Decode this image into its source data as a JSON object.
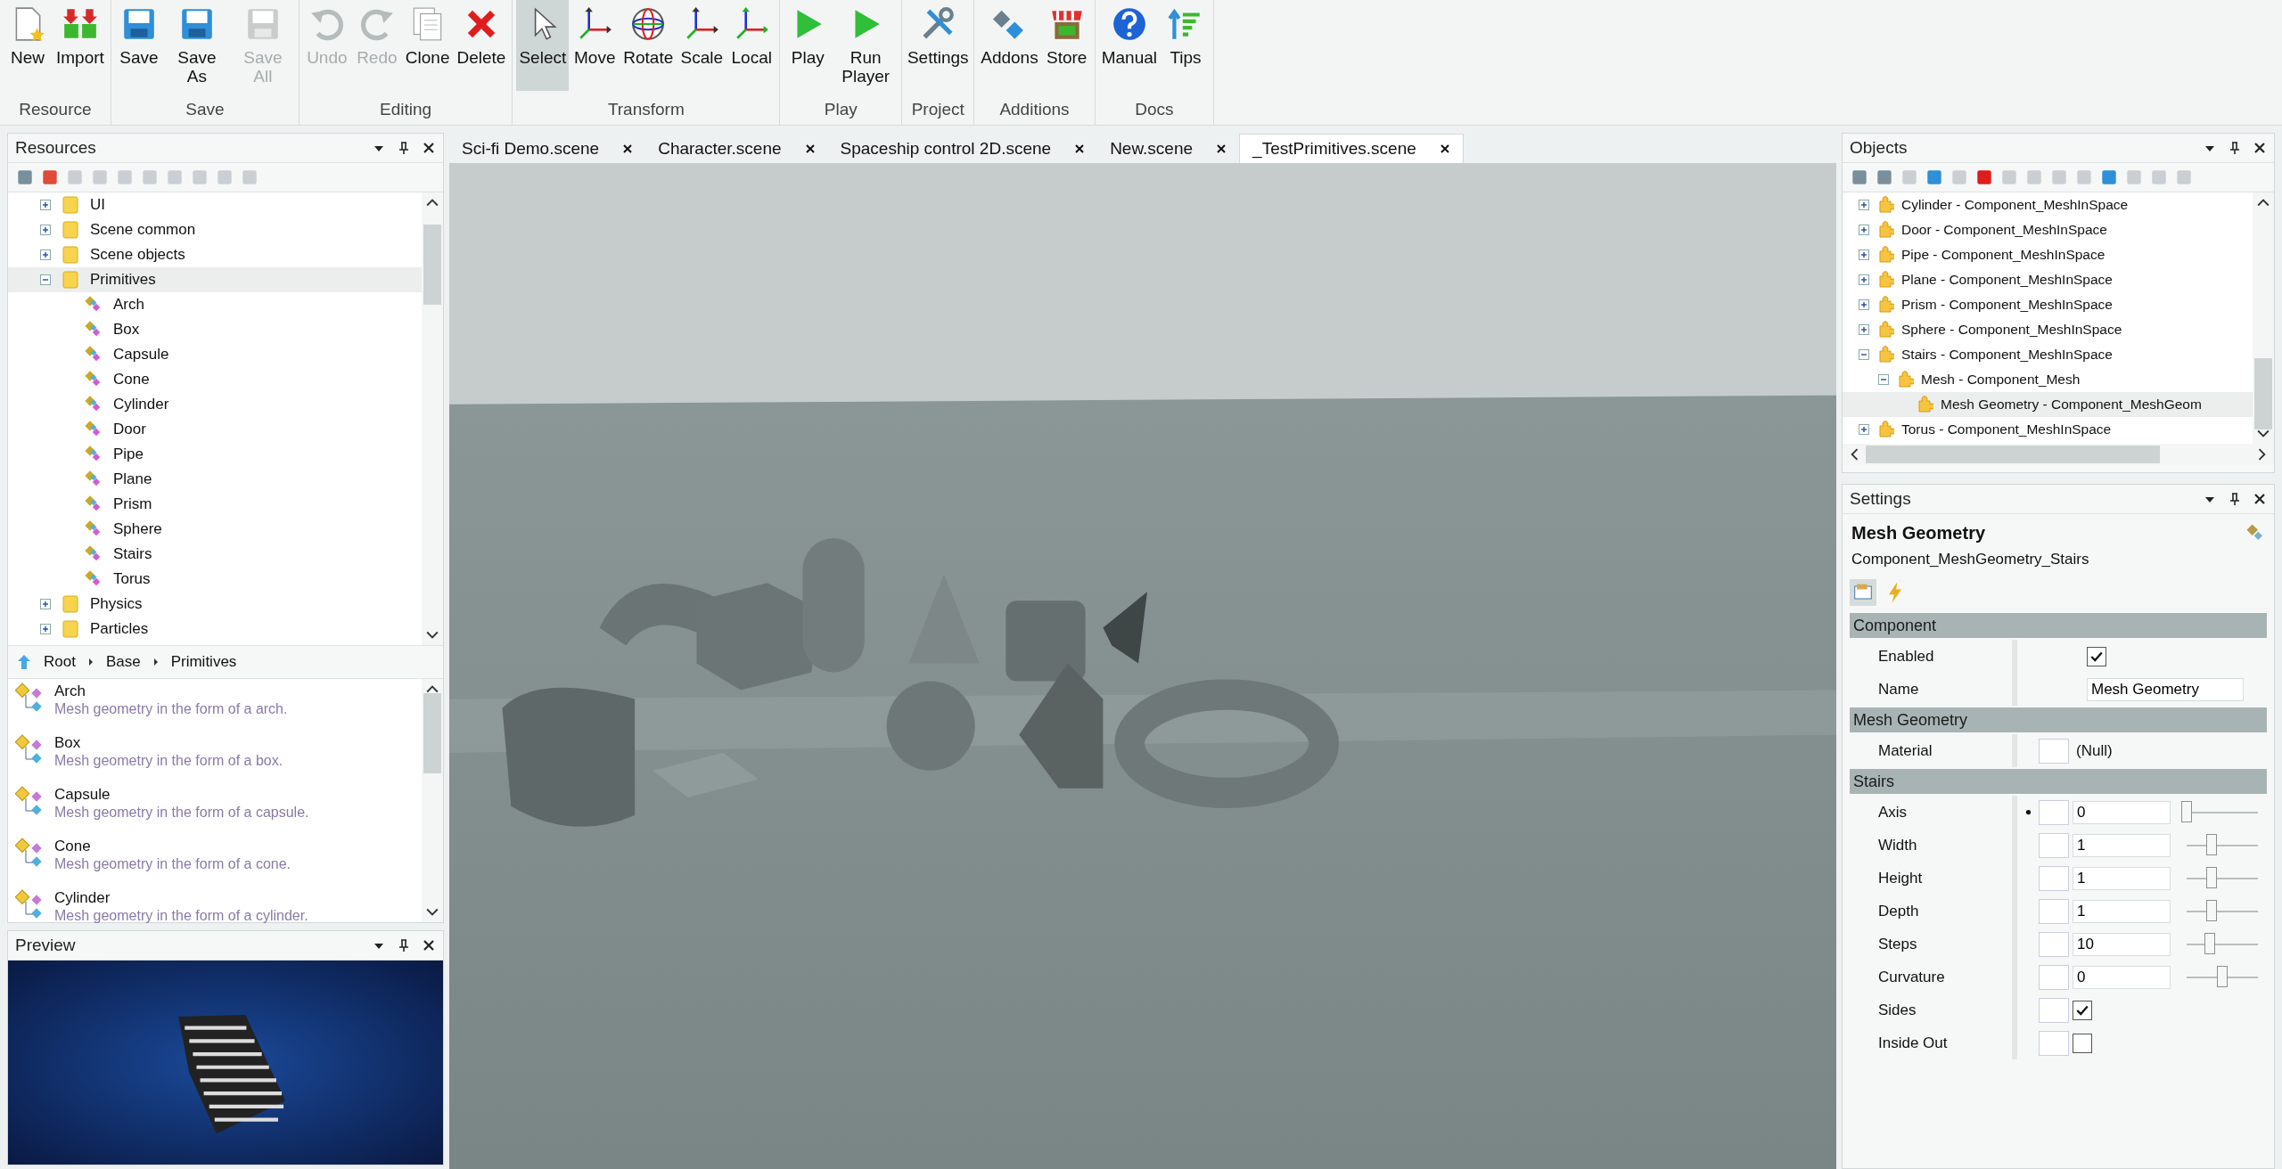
{
  "toolbar": {
    "groups": [
      {
        "label": "Resource",
        "buttons": [
          {
            "label": "New",
            "disabled": false,
            "selected": false
          },
          {
            "label": "Import",
            "disabled": false,
            "selected": false
          }
        ]
      },
      {
        "label": "Save",
        "buttons": [
          {
            "label": "Save",
            "disabled": false,
            "selected": false
          },
          {
            "label": "Save As",
            "disabled": false,
            "selected": false
          },
          {
            "label": "Save All",
            "disabled": true,
            "selected": false
          }
        ]
      },
      {
        "label": "Editing",
        "buttons": [
          {
            "label": "Undo",
            "disabled": true,
            "selected": false
          },
          {
            "label": "Redo",
            "disabled": true,
            "selected": false
          },
          {
            "label": "Clone",
            "disabled": false,
            "selected": false
          },
          {
            "label": "Delete",
            "disabled": false,
            "selected": false
          }
        ]
      },
      {
        "label": "Transform",
        "buttons": [
          {
            "label": "Select",
            "disabled": false,
            "selected": true
          },
          {
            "label": "Move",
            "disabled": false,
            "selected": false
          },
          {
            "label": "Rotate",
            "disabled": false,
            "selected": false
          },
          {
            "label": "Scale",
            "disabled": false,
            "selected": false
          },
          {
            "label": "Local",
            "disabled": false,
            "selected": false
          }
        ]
      },
      {
        "label": "Play",
        "buttons": [
          {
            "label": "Play",
            "disabled": false,
            "selected": false
          },
          {
            "label": "Run Player",
            "disabled": false,
            "selected": false
          }
        ]
      },
      {
        "label": "Project",
        "buttons": [
          {
            "label": "Settings",
            "disabled": false,
            "selected": false
          }
        ]
      },
      {
        "label": "Additions",
        "buttons": [
          {
            "label": "Addons",
            "disabled": false,
            "selected": false
          },
          {
            "label": "Store",
            "disabled": false,
            "selected": false
          }
        ]
      },
      {
        "label": "Docs",
        "buttons": [
          {
            "label": "Manual",
            "disabled": false,
            "selected": false
          },
          {
            "label": "Tips",
            "disabled": false,
            "selected": false
          }
        ]
      }
    ]
  },
  "resources": {
    "title": "Resources",
    "tree": [
      {
        "label": "UI",
        "kind": "folder",
        "expanded": false,
        "selected": false
      },
      {
        "label": "Scene common",
        "kind": "folder",
        "expanded": false,
        "selected": false
      },
      {
        "label": "Scene objects",
        "kind": "folder",
        "expanded": false,
        "selected": false
      },
      {
        "label": "Primitives",
        "kind": "folder",
        "expanded": true,
        "selected": true,
        "children": [
          {
            "label": "Arch",
            "kind": "resource",
            "selected": false
          },
          {
            "label": "Box",
            "kind": "resource",
            "selected": false
          },
          {
            "label": "Capsule",
            "kind": "resource",
            "selected": false
          },
          {
            "label": "Cone",
            "kind": "resource",
            "selected": false
          },
          {
            "label": "Cylinder",
            "kind": "resource",
            "selected": false
          },
          {
            "label": "Door",
            "kind": "resource",
            "selected": false
          },
          {
            "label": "Pipe",
            "kind": "resource",
            "selected": false
          },
          {
            "label": "Plane",
            "kind": "resource",
            "selected": false
          },
          {
            "label": "Prism",
            "kind": "resource",
            "selected": false
          },
          {
            "label": "Sphere",
            "kind": "resource",
            "selected": false
          },
          {
            "label": "Stairs",
            "kind": "resource",
            "selected": false
          },
          {
            "label": "Torus",
            "kind": "resource",
            "selected": false
          }
        ]
      },
      {
        "label": "Physics",
        "kind": "folder",
        "expanded": false,
        "selected": false
      },
      {
        "label": "Particles",
        "kind": "folder",
        "expanded": false,
        "selected": false
      }
    ],
    "breadcrumb": [
      "Root",
      "Base",
      "Primitives"
    ],
    "list": [
      {
        "name": "Arch",
        "description": "Mesh geometry in the form of a arch."
      },
      {
        "name": "Box",
        "description": "Mesh geometry in the form of a box."
      },
      {
        "name": "Capsule",
        "description": "Mesh geometry in the form of a capsule."
      },
      {
        "name": "Cone",
        "description": "Mesh geometry in the form of a cone."
      },
      {
        "name": "Cylinder",
        "description": "Mesh geometry in the form of a cylinder."
      }
    ]
  },
  "preview": {
    "title": "Preview",
    "kind": "picture"
  },
  "tabs": [
    {
      "label": "Sci-fi Demo.scene",
      "selected": false
    },
    {
      "label": "Character.scene",
      "selected": false
    },
    {
      "label": "Spaceship control 2D.scene",
      "selected": false
    },
    {
      "label": "New.scene",
      "selected": false
    },
    {
      "label": "_TestPrimitives.scene",
      "selected": true
    }
  ],
  "objects": {
    "title": "Objects",
    "tree": [
      {
        "label": "Cylinder - Component_MeshInSpace",
        "expanded": false,
        "selected": false
      },
      {
        "label": "Door - Component_MeshInSpace",
        "expanded": false,
        "selected": false
      },
      {
        "label": "Pipe - Component_MeshInSpace",
        "expanded": false,
        "selected": false
      },
      {
        "label": "Plane - Component_MeshInSpace",
        "expanded": false,
        "selected": false
      },
      {
        "label": "Prism - Component_MeshInSpace",
        "expanded": false,
        "selected": false
      },
      {
        "label": "Sphere - Component_MeshInSpace",
        "expanded": false,
        "selected": false
      },
      {
        "label": "Stairs - Component_MeshInSpace",
        "expanded": true,
        "selected": false,
        "children": [
          {
            "label": "Mesh - Component_Mesh",
            "expanded": true,
            "selected": false,
            "children": [
              {
                "label": "Mesh Geometry - Component_MeshGeom",
                "selected": true
              }
            ]
          }
        ]
      },
      {
        "label": "Torus - Component_MeshInSpace",
        "expanded": false,
        "selected": false
      }
    ]
  },
  "settings": {
    "title": "Settings",
    "object_name": "Mesh Geometry",
    "object_type": "Component_MeshGeometry_Stairs",
    "sections": [
      {
        "title": "Component",
        "rows": [
          {
            "label": "Enabled",
            "kind": "checkbox",
            "checked": true,
            "linkable": false,
            "marked": false
          },
          {
            "label": "Name",
            "kind": "text",
            "value": "Mesh Geometry",
            "linkable": false,
            "marked": false
          }
        ]
      },
      {
        "title": "Mesh Geometry",
        "rows": [
          {
            "label": "Material",
            "kind": "reference",
            "value": "(Null)",
            "linkable": true,
            "marked": false
          }
        ]
      },
      {
        "title": "Stairs",
        "rows": [
          {
            "label": "Axis",
            "kind": "slider",
            "value": "0",
            "level": 0.0,
            "linkable": true,
            "marked": true
          },
          {
            "label": "Width",
            "kind": "slider",
            "value": "1",
            "level": 0.35,
            "linkable": true,
            "marked": false
          },
          {
            "label": "Height",
            "kind": "slider",
            "value": "1",
            "level": 0.35,
            "linkable": true,
            "marked": false
          },
          {
            "label": "Depth",
            "kind": "slider",
            "value": "1",
            "level": 0.35,
            "linkable": true,
            "marked": false
          },
          {
            "label": "Steps",
            "kind": "slider",
            "value": "10",
            "level": 0.33,
            "linkable": true,
            "marked": false
          },
          {
            "label": "Curvature",
            "kind": "slider",
            "value": "0",
            "level": 0.5,
            "linkable": true,
            "marked": false
          },
          {
            "label": "Sides",
            "kind": "checkbox",
            "checked": true,
            "linkable": true,
            "marked": false
          },
          {
            "label": "Inside Out",
            "kind": "checkbox",
            "checked": false,
            "linkable": true,
            "marked": false
          }
        ]
      }
    ]
  }
}
